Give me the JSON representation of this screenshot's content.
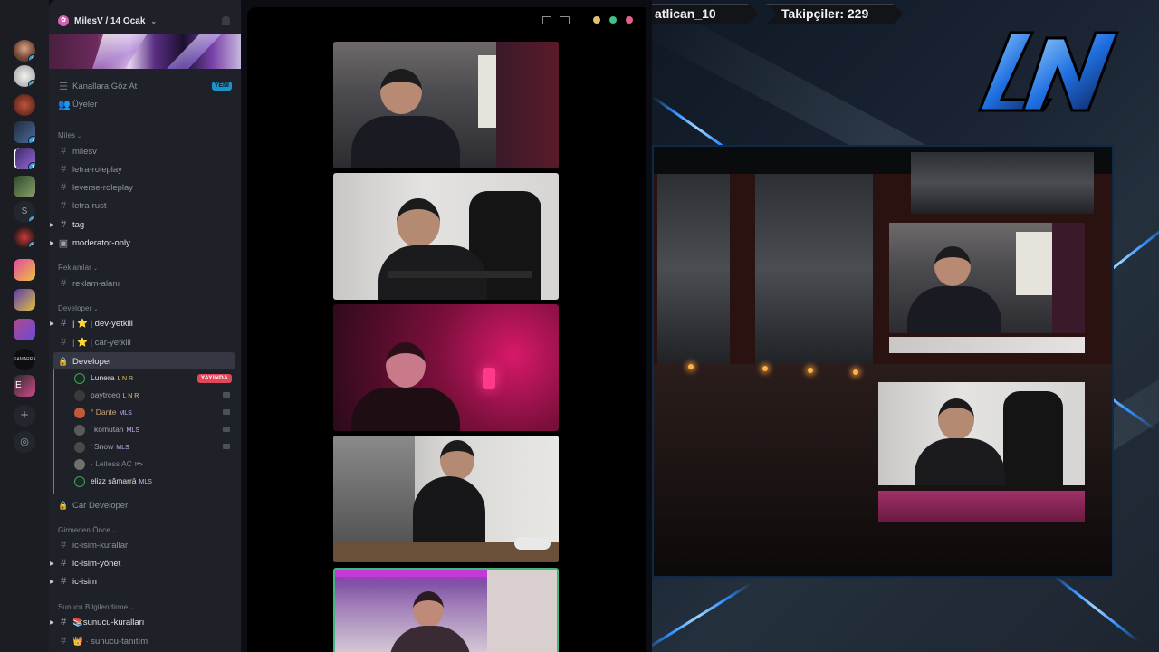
{
  "server": {
    "name": "MilesV / 14 Ocak",
    "badges": [
      "2",
      "1",
      "1",
      "1",
      "1",
      "2"
    ]
  },
  "sidebar": {
    "browse_channels": "Kanallara Göz At",
    "browse_badge": "YENİ",
    "members": "Üyeler",
    "categories": {
      "miles": "Miles",
      "reklamlar": "Reklamlar",
      "developer": "Developer",
      "girmeden_once": "Girmeden Önce",
      "sunucu_bilgi": "Sunucu Bilgilendirme"
    },
    "miles_channels": [
      "milesv",
      "letra-roleplay",
      "leverse-roleplay",
      "letra-rust",
      "tag",
      "moderator-only"
    ],
    "reklam_channels": [
      "reklam-alanı"
    ],
    "dev_channels": [
      "| ⭐ | dev-yetkili",
      "| ⭐ | car-yetkili"
    ],
    "voice_channel": "Developer",
    "voice_users": [
      {
        "name": "Lunera",
        "tag": "L N R",
        "live": "YAYINDA"
      },
      {
        "name": "paytrceo",
        "tag": "L N R"
      },
      {
        "name": "° Dante",
        "tag": "MLS"
      },
      {
        "name": "' komutan",
        "tag": "MLS"
      },
      {
        "name": "' Snow",
        "tag": "MLS"
      },
      {
        "name": "· Leitess AC",
        "tag": "!*>"
      },
      {
        "name": "elizz sâmarrā",
        "tag": "MLS"
      }
    ],
    "car_developer": "Car Developer",
    "rules_channels": [
      "ic-isim-kurallar",
      "ic-isim-yönet",
      "ic-isim"
    ],
    "info_channels": [
      "sunucu-kuralları",
      "sunucu-tanıtım"
    ]
  },
  "stream": {
    "username": "atlican_10",
    "followers": "Takipçiler: 229",
    "logo": "LN"
  },
  "colors": {
    "accent": "#1f93c9",
    "live": "#e0475b",
    "voice_green": "#3aa55a",
    "dot_yellow": "#e3c16f",
    "dot_green": "#3fc28a",
    "dot_pink": "#e8608a"
  }
}
